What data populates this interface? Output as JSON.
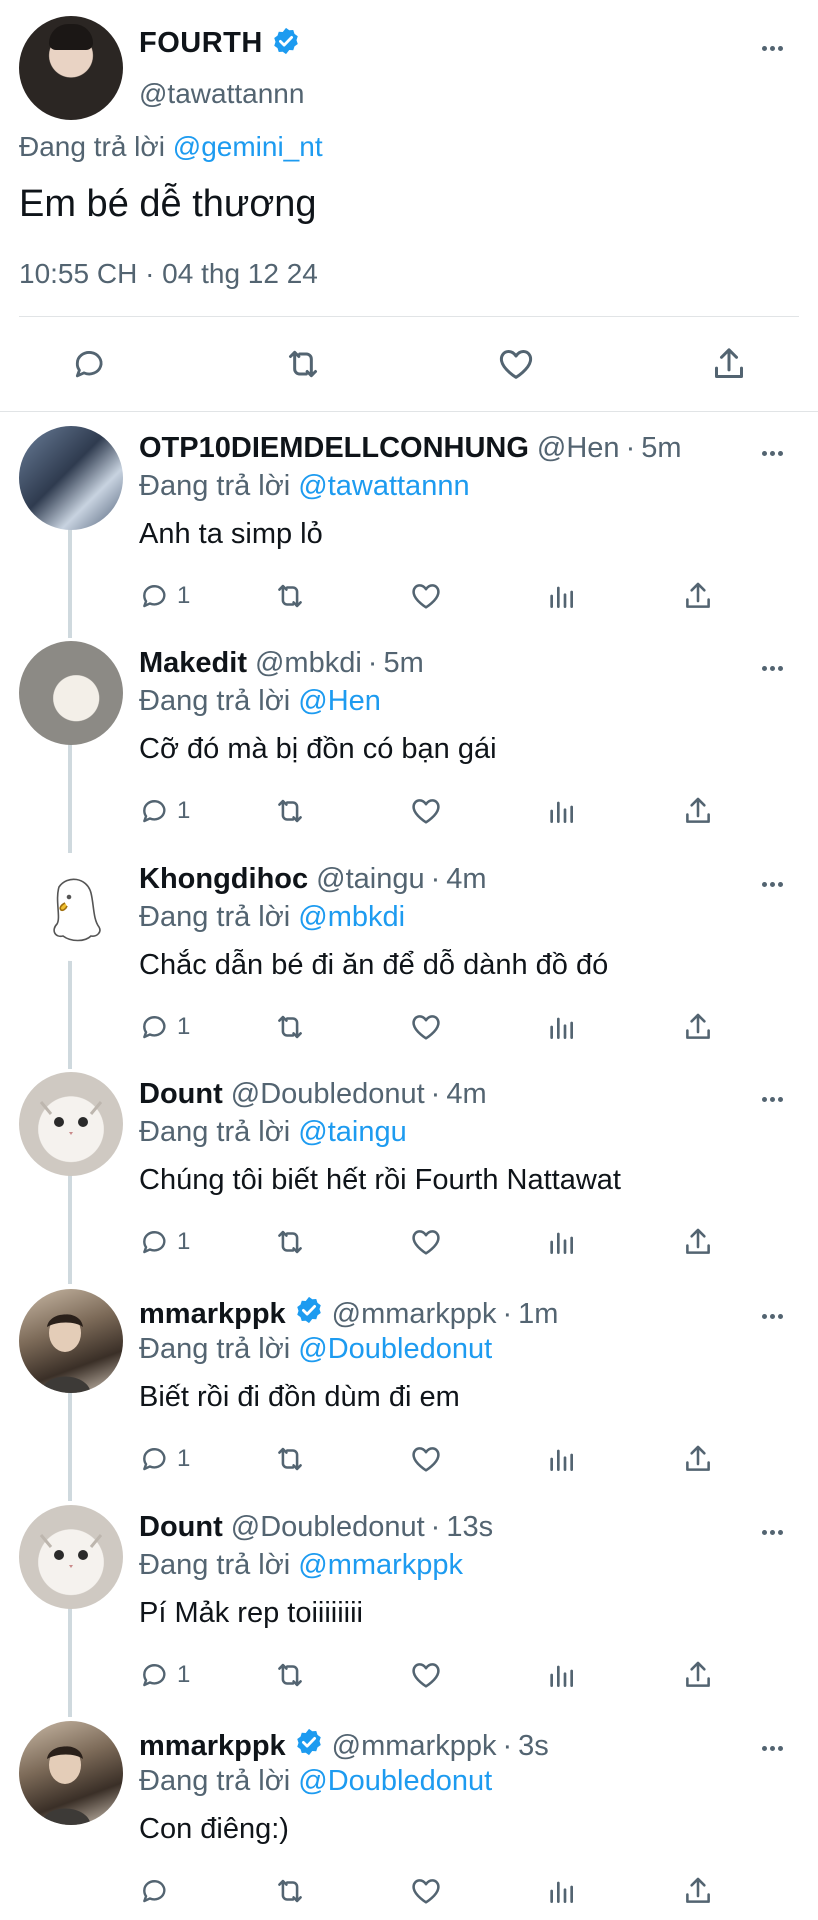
{
  "main_tweet": {
    "author_name": "FOURTH",
    "verified": true,
    "handle": "@tawattannn",
    "replying_prefix": "Đang trả lời ",
    "replying_to": "@gemini_nt",
    "text": "Em bé dễ thương",
    "timestamp": "10:55 CH · 04 thg 12 24",
    "actions": [
      "reply-icon",
      "retweet-icon",
      "like-icon",
      "share-icon"
    ]
  },
  "colors": {
    "accent": "#1d9bf0",
    "secondary_text": "#536471",
    "primary_text": "#0f1419",
    "divider": "#e1e4e6"
  },
  "replies": [
    {
      "name": "OTP10DIEMDELLCONHUNG",
      "verified": false,
      "handle": "@Hen",
      "sep": "·",
      "time": "5m",
      "replying_prefix": "Đang trả lời ",
      "replying_to": "@tawattannn",
      "text": "Anh ta simp lỏ",
      "reply_count": "1"
    },
    {
      "name": "Makedit",
      "verified": false,
      "handle": "@mbkdi",
      "sep": "·",
      "time": "5m",
      "replying_prefix": "Đang trả lời ",
      "replying_to": "@Hen",
      "text": "Cỡ đó mà bị đồn có bạn gái",
      "reply_count": "1"
    },
    {
      "name": "Khongdihoc",
      "verified": false,
      "handle": "@taingu",
      "sep": "·",
      "time": "4m",
      "replying_prefix": "Đang trả lời ",
      "replying_to": "@mbkdi",
      "text": "Chắc dẫn bé đi ăn để dỗ dành đồ đó",
      "reply_count": "1"
    },
    {
      "name": "Dount",
      "verified": false,
      "handle": "@Doubledonut",
      "sep": "·",
      "time": "4m",
      "replying_prefix": "Đang trả lời ",
      "replying_to": "@taingu",
      "text": "Chúng tôi biết hết rồi Fourth Nattawat",
      "reply_count": "1"
    },
    {
      "name": "mmarkppk",
      "verified": true,
      "handle": "@mmarkppk",
      "sep": "·",
      "time": "1m",
      "replying_prefix": "Đang trả lời ",
      "replying_to": "@Doubledonut",
      "text": "Biết rồi đi đồn dùm đi em",
      "reply_count": "1"
    },
    {
      "name": "Dount",
      "verified": false,
      "handle": "@Doubledonut",
      "sep": "·",
      "time": "13s",
      "replying_prefix": "Đang trả lời ",
      "replying_to": "@mmarkppk",
      "text": "Pí Mảk rep toiiiiiiii",
      "reply_count": "1"
    },
    {
      "name": "mmarkppk",
      "verified": true,
      "handle": "@mmarkppk",
      "sep": "·",
      "time": "3s",
      "replying_prefix": "Đang trả lời ",
      "replying_to": "@Doubledonut",
      "text": "Con điêng:)",
      "reply_count": ""
    }
  ]
}
